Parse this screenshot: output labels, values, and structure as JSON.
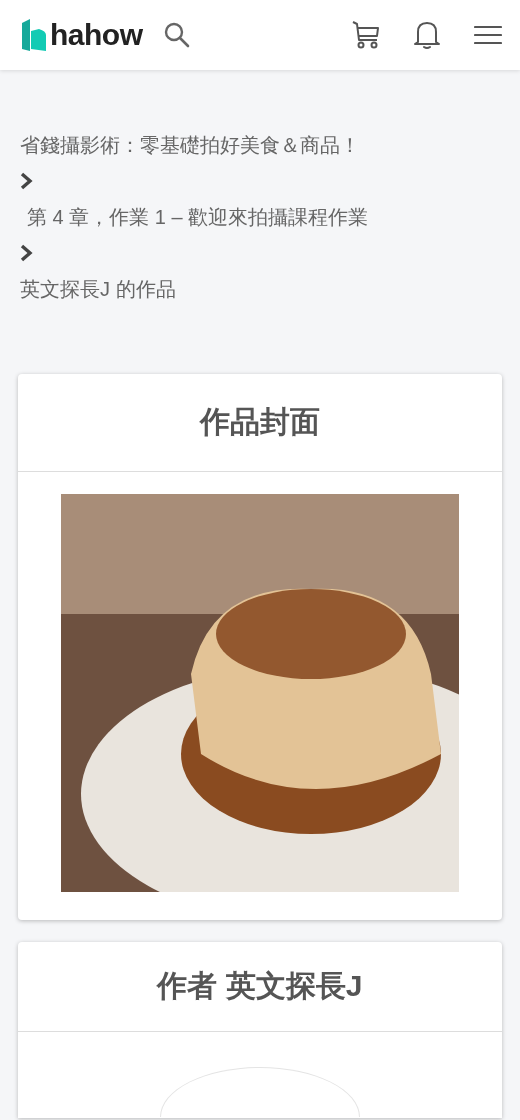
{
  "header": {
    "logo_text": "hahow"
  },
  "breadcrumbs": [
    "省錢攝影術：零基礎拍好美食＆商品！",
    "第 4 章，作業 1 – 歡迎來拍攝課程作業",
    "英文探長J 的作品"
  ],
  "cover_card": {
    "title": "作品封面"
  },
  "author_card": {
    "title": "作者 英文探長J"
  }
}
